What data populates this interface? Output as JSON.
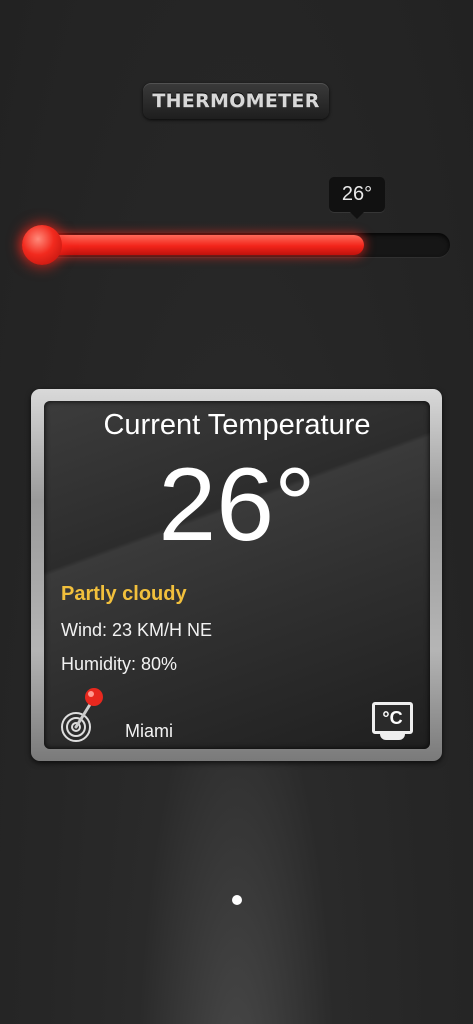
{
  "header": {
    "title": "THERMOMETER"
  },
  "slider": {
    "value_label": "26°",
    "value": 26,
    "fill_fraction": 0.8
  },
  "card": {
    "heading": "Current Temperature",
    "temperature": "26°",
    "condition": "Partly cloudy",
    "wind": "Wind: 23 KM/H NE",
    "humidity": "Humidity: 80%",
    "city": "Miami",
    "unit_label": "°C",
    "location_icon": "map-pin-target-icon",
    "unit_icon": "celsius-toggle-icon"
  },
  "pager": {
    "pages": 1,
    "current": 1
  },
  "colors": {
    "accent_red": "#f2241a",
    "condition_yellow": "#f2c03c"
  }
}
